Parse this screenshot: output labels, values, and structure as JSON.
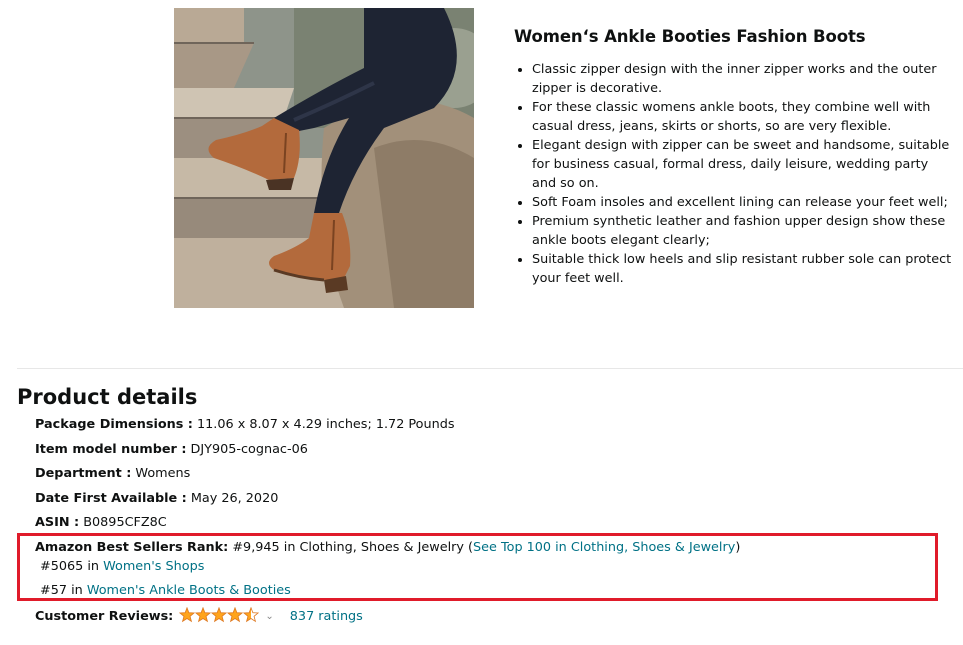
{
  "product_info": {
    "title": "Women‘s Ankle Booties Fashion Boots",
    "features": [
      "Classic zipper design with the inner zipper works and the outer zipper is decorative.",
      "For these classic womens ankle boots, they combine well with casual dress, jeans, skirts or shorts, so are very flexible.",
      "Elegant design with zipper can be sweet and handsome, suitable for business casual, formal dress, daily leisure, wedding party and so on.",
      "Soft Foam insoles and excellent lining can release your feet well;",
      "Premium synthetic leather and fashion upper design show these ankle boots elegant clearly;",
      "Suitable thick low heels and slip resistant rubber sole can protect your feet well."
    ]
  },
  "product_details": {
    "heading": "Product details",
    "package_dimensions": {
      "label": "Package Dimensions :",
      "value": " 11.06 x 8.07 x 4.29 inches; 1.72 Pounds"
    },
    "item_model_number": {
      "label": "Item model number :",
      "value": " DJY905-cognac-06"
    },
    "department": {
      "label": "Department :",
      "value": " Womens"
    },
    "date_first_available": {
      "label": "Date First Available :",
      "value": " May 26, 2020"
    },
    "asin": {
      "label": "ASIN :",
      "value": " B0895CFZ8C"
    },
    "best_sellers_rank": {
      "label": "Amazon Best Sellers Rank:",
      "main_rank": " #9,945 in Clothing, Shoes & Jewelry (",
      "top100_link": "See Top 100 in Clothing, Shoes & Jewelry",
      "main_rank_close": ")",
      "sub_ranks": [
        {
          "rank": "#5065 in ",
          "category": "Women's Shops"
        },
        {
          "rank": "#57 in ",
          "category": "Women's Ankle Boots & Booties"
        }
      ]
    },
    "customer_reviews": {
      "label": "Customer Reviews:",
      "rating": 4.5,
      "ratings_count": "837 ratings"
    }
  },
  "colors": {
    "link": "#007185",
    "star": "#ffa41c",
    "highlight_border": "#e01b2a"
  },
  "icons": {
    "rating": "star-rating-icon",
    "expand": "chevron-down-icon"
  }
}
